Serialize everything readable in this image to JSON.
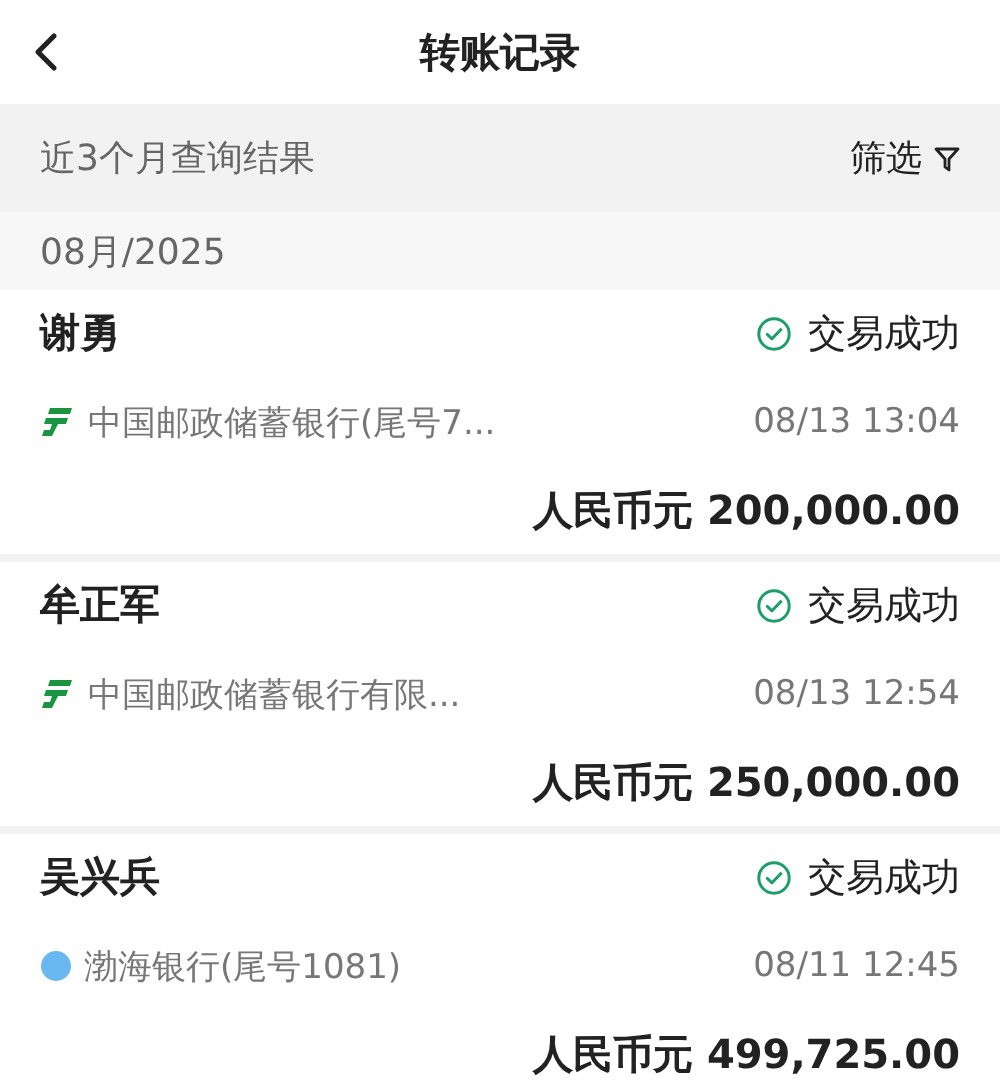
{
  "header": {
    "title": "转账记录"
  },
  "filter_bar": {
    "summary": "近3个月查询结果",
    "filter_label": "筛选"
  },
  "month": "08月/2025",
  "records": [
    {
      "name": "谢勇",
      "status": "交易成功",
      "kind": "postal",
      "bank": "中国邮政储蓄银行(尾号7...",
      "time": "08/13 13:04",
      "amount": "人民币元 200,000.00"
    },
    {
      "name": "牟正军",
      "status": "交易成功",
      "kind": "postal",
      "bank": "中国邮政储蓄银行有限...",
      "time": "08/13 12:54",
      "amount": "人民币元 250,000.00"
    },
    {
      "name": "吴兴兵",
      "status": "交易成功",
      "kind": "other",
      "bank": "渤海银行(尾号1081)",
      "time": "08/11 12:45",
      "amount": "人民币元 499,725.00"
    }
  ]
}
